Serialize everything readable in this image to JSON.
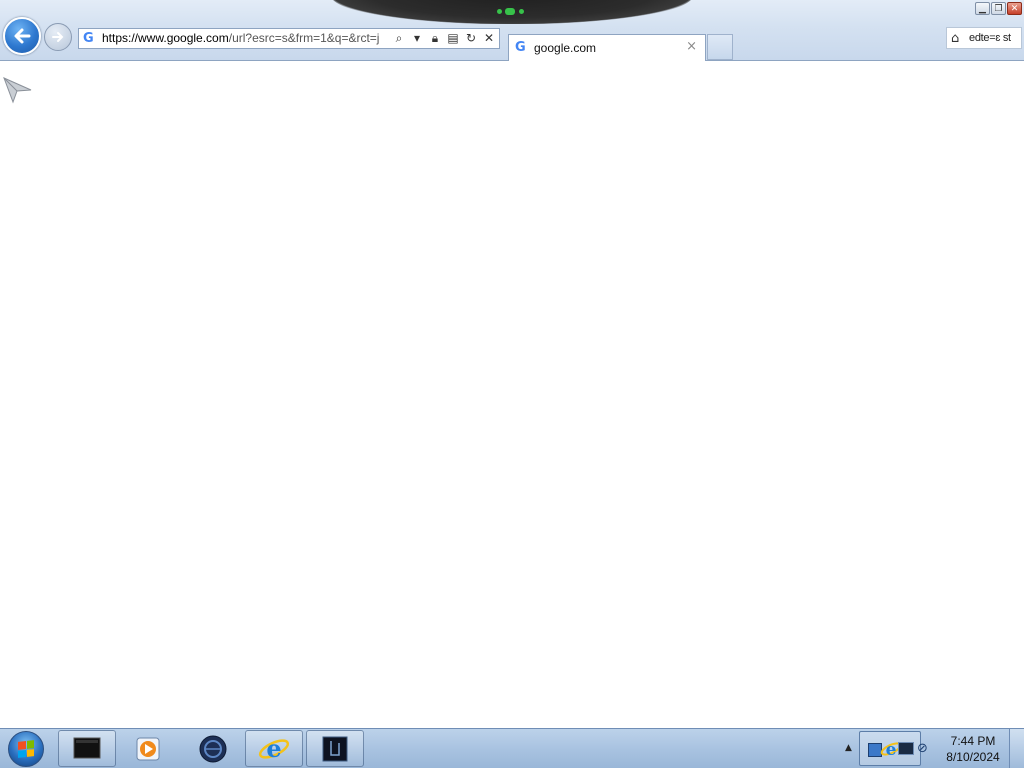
{
  "browser": {
    "address": {
      "host": "https://www.google.com",
      "rest": "/url?esrc=s&frm=1&q=&rct=j"
    },
    "tab": {
      "title": "google.com",
      "close_glyph": "×"
    },
    "toolbar_right_text": "edte=ɛ st",
    "icons": {
      "back": "back-arrow-icon",
      "forward": "forward-arrow-icon",
      "search": "search-icon",
      "lock": "lock-icon",
      "compat": "compatibility-icon",
      "refresh": "refresh-icon",
      "stop": "stop-icon",
      "home": "home-icon"
    },
    "window_buttons": {
      "minimize": "▁",
      "restore": "❐",
      "close": "✕"
    }
  },
  "taskbar": {
    "clock_time": "7:44 PM",
    "clock_date": "8/10/2024",
    "items": [
      "app-black-window-icon",
      "media-player-icon",
      "globe-app-icon",
      "internet-explorer-icon",
      "dark-app-icon"
    ]
  },
  "colors": {
    "chrome_top": "#e3ecf7",
    "taskbar": "#a9c3e1",
    "back_button": "#2e78cf",
    "notch_led": "#37c24a"
  }
}
